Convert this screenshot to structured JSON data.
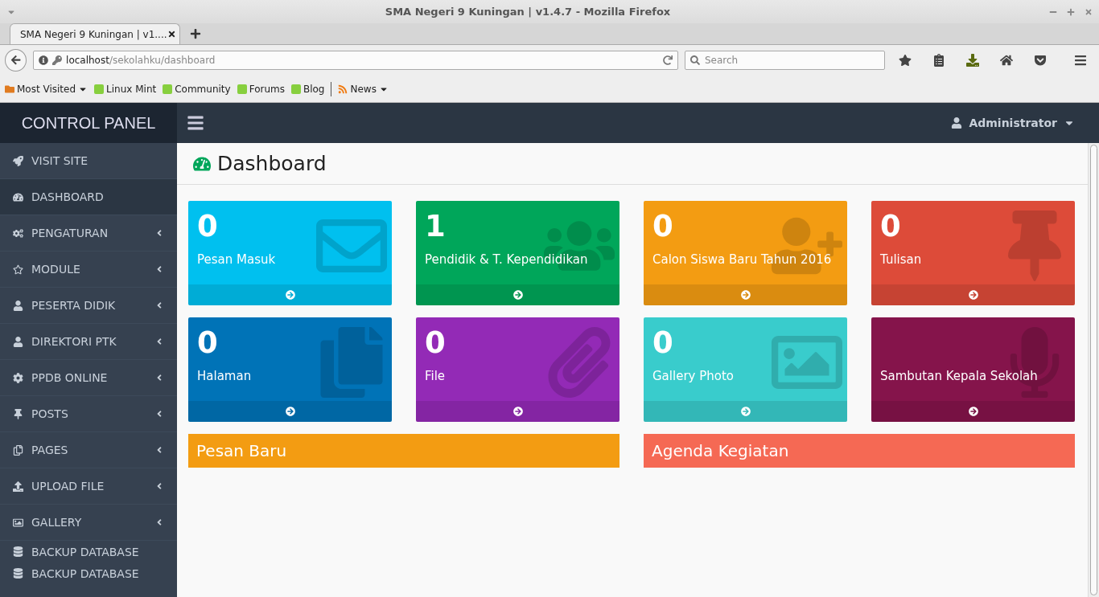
{
  "browser": {
    "title": "SMA Negeri 9 Kuningan | v1.4.7 - Mozilla Firefox",
    "tab": {
      "title": "SMA Negeri 9 Kuningan | v1...."
    },
    "address": {
      "host": "localhost",
      "path": "/sekolahku/dashboard"
    },
    "search": {
      "placeholder": "Search"
    },
    "bookmarks": [
      {
        "label": "Most Visited",
        "kind": "folder",
        "menu": true
      },
      {
        "label": "Linux Mint",
        "kind": "site",
        "menu": false
      },
      {
        "label": "Community",
        "kind": "site",
        "menu": false
      },
      {
        "label": "Forums",
        "kind": "site",
        "menu": false
      },
      {
        "label": "Blog",
        "kind": "site",
        "menu": false
      },
      {
        "label": "News",
        "kind": "feed",
        "menu": true
      }
    ]
  },
  "app": {
    "brand": "CONTROL PANEL",
    "user": "Administrator",
    "sidebar": [
      {
        "label": "VISIT SITE",
        "selected": false,
        "expandable": false
      },
      {
        "label": "DASHBOARD",
        "selected": true,
        "expandable": false
      },
      {
        "label": "PENGATURAN",
        "selected": false,
        "expandable": true
      },
      {
        "label": "MODULE",
        "selected": false,
        "expandable": true
      },
      {
        "label": "PESERTA DIDIK",
        "selected": false,
        "expandable": true
      },
      {
        "label": "DIREKTORI PTK",
        "selected": false,
        "expandable": true
      },
      {
        "label": "PPDB ONLINE",
        "selected": false,
        "expandable": true
      },
      {
        "label": "POSTS",
        "selected": false,
        "expandable": true
      },
      {
        "label": "PAGES",
        "selected": false,
        "expandable": true
      },
      {
        "label": "UPLOAD FILE",
        "selected": false,
        "expandable": true
      },
      {
        "label": "GALLERY",
        "selected": false,
        "expandable": true
      },
      {
        "label": "BACKUP DATABASE",
        "selected": false,
        "expandable": false
      },
      {
        "label": "BACKUP DATABASE",
        "selected": false,
        "expandable": false
      }
    ],
    "page_title": "Dashboard",
    "boxes": [
      {
        "count": "0",
        "label": "Pesan Masuk",
        "color": "#00c0ef"
      },
      {
        "count": "1",
        "label": "Pendidik & T. Kependidikan",
        "color": "#00a65a"
      },
      {
        "count": "0",
        "label": "Calon Siswa Baru Tahun 2016",
        "color": "#f39c12"
      },
      {
        "count": "0",
        "label": "Tulisan",
        "color": "#dd4b39"
      },
      {
        "count": "0",
        "label": "Halaman",
        "color": "#0073b7"
      },
      {
        "count": "0",
        "label": "File",
        "color": "#932ab6"
      },
      {
        "count": "0",
        "label": "Gallery Photo",
        "color": "#39cccc"
      },
      {
        "label": "Sambutan Kepala Sekolah",
        "color": "#85144b"
      }
    ],
    "panels": [
      {
        "title": "Pesan Baru",
        "color": "#f39c12"
      },
      {
        "title": "Agenda Kegiatan",
        "color": "#f56954"
      }
    ]
  }
}
